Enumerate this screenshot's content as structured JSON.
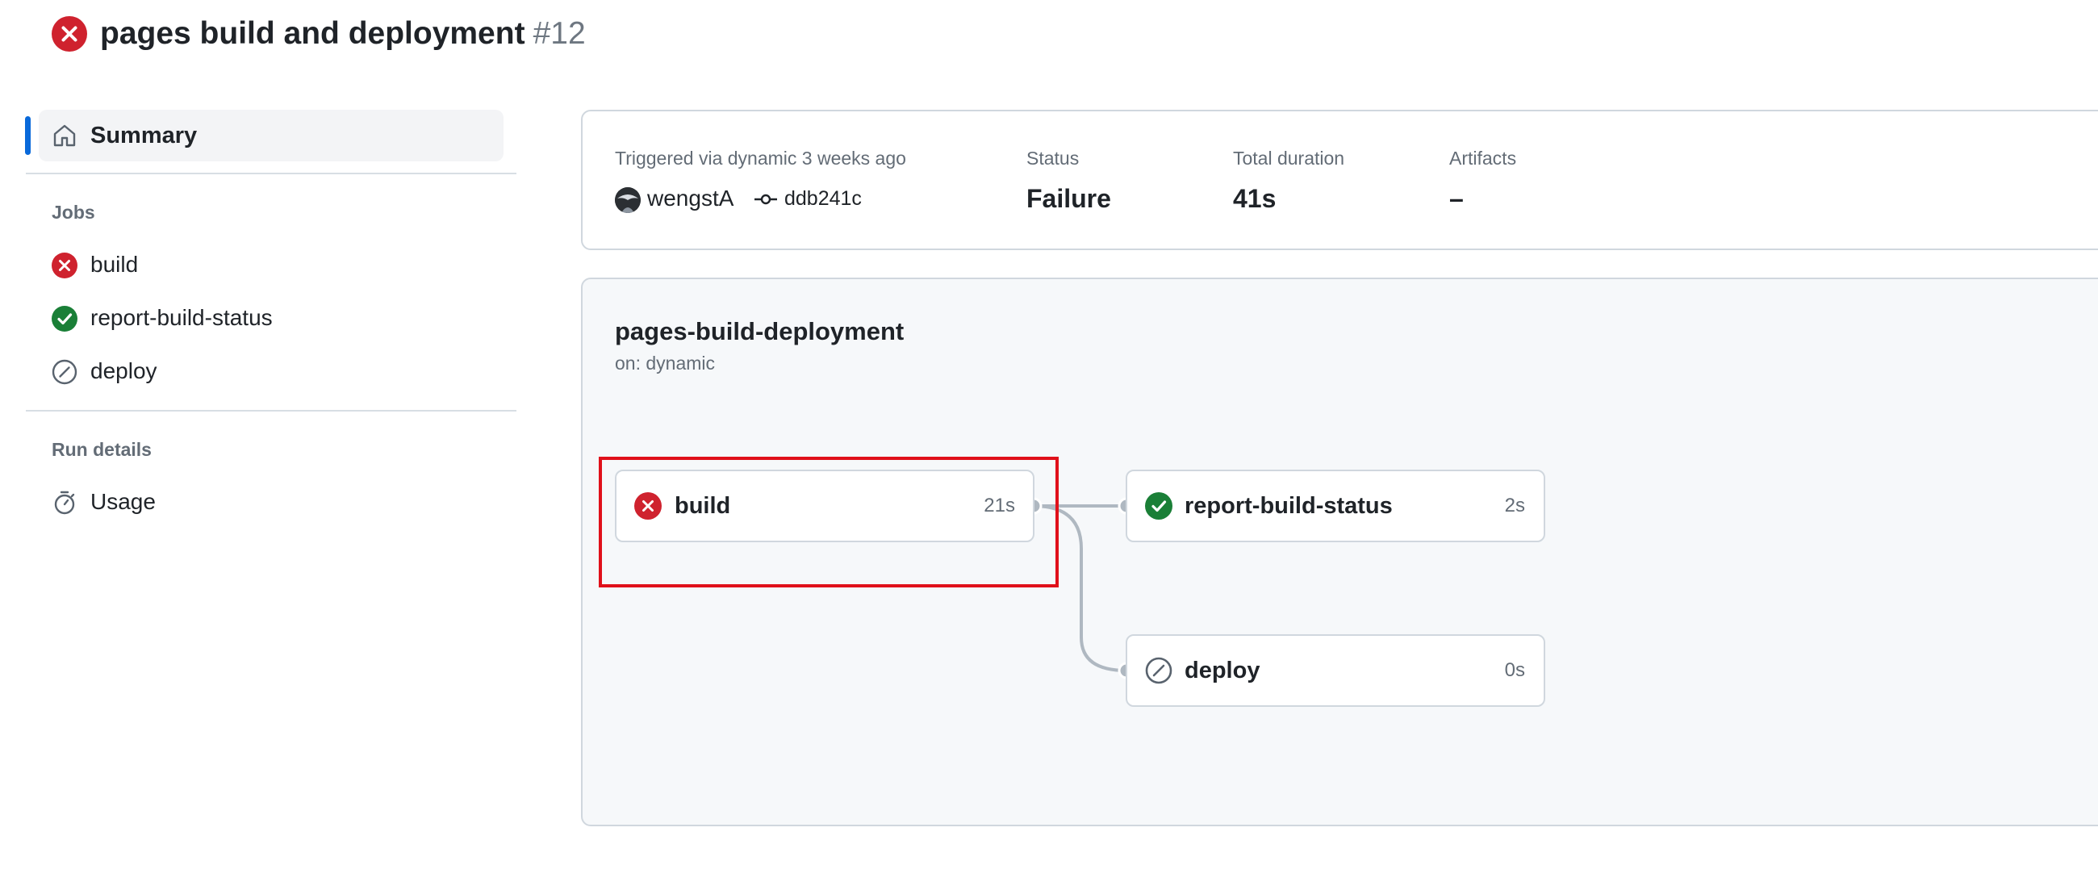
{
  "header": {
    "title": "pages build and deployment",
    "run_number": "#12",
    "status_icon": "x-circle-fill-icon",
    "status_color": "#cf222e"
  },
  "sidebar": {
    "summary_label": "Summary",
    "jobs_heading": "Jobs",
    "jobs": [
      {
        "label": "build",
        "status": "failure",
        "icon": "x-circle-fill-icon"
      },
      {
        "label": "report-build-status",
        "status": "success",
        "icon": "check-circle-fill-icon"
      },
      {
        "label": "deploy",
        "status": "skipped",
        "icon": "skip-icon"
      }
    ],
    "run_details_heading": "Run details",
    "usage_label": "Usage"
  },
  "summary": {
    "triggered_text": "Triggered via dynamic 3 weeks ago",
    "actor": "wengstA",
    "commit": "ddb241c",
    "status_label": "Status",
    "status_value": "Failure",
    "duration_label": "Total duration",
    "duration_value": "41s",
    "artifacts_label": "Artifacts",
    "artifacts_value": "–"
  },
  "workflow": {
    "name": "pages-build-deployment",
    "trigger": "on: dynamic",
    "jobs": [
      {
        "label": "build",
        "duration": "21s",
        "status": "failure"
      },
      {
        "label": "report-build-status",
        "duration": "2s",
        "status": "success"
      },
      {
        "label": "deploy",
        "duration": "0s",
        "status": "skipped"
      }
    ]
  },
  "colors": {
    "failure": "#cf222e",
    "success": "#1a7f37",
    "accent": "#0969da",
    "highlight": "#e0101a"
  }
}
